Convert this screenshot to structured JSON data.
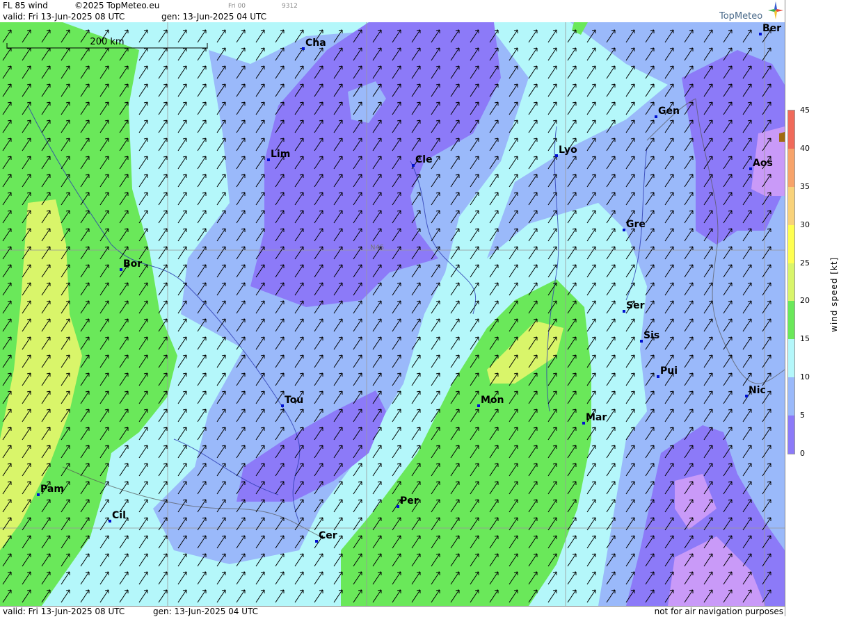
{
  "header": {
    "product": "FL 85 wind",
    "copyright": "©2025 TopMeteo.eu",
    "run_short": "Fri 00",
    "code": "9312",
    "valid": "valid:  Fri  13-Jun-2025  08 UTC",
    "gen": "gen: 13-Jun-2025 04 UTC"
  },
  "footer": {
    "valid": "valid:  Fri  13-Jun-2025  08 UTC",
    "gen": "gen: 13-Jun-2025 04 UTC",
    "disclaimer": "not for air navigation purposes"
  },
  "logo": {
    "text": "TopMeteo"
  },
  "scale_bar": {
    "label": "200 km"
  },
  "gridline_label": "N45",
  "legend": {
    "title": "wind  speed  [kt]",
    "ticks": [
      "45",
      "40",
      "35",
      "30",
      "25",
      "20",
      "15",
      "10",
      "5",
      "0"
    ],
    "colors": [
      "#f06a5a",
      "#f7a36a",
      "#f8d27a",
      "#ffff50",
      "#d9f56a",
      "#6ae85a",
      "#b4f7fa",
      "#9ab9fa",
      "#8c7af8",
      "#c99af8"
    ]
  },
  "cities": [
    {
      "name": "Cha"
    },
    {
      "name": "Lim"
    },
    {
      "name": "Cle"
    },
    {
      "name": "Lyo"
    },
    {
      "name": "Gen"
    },
    {
      "name": "Ber"
    },
    {
      "name": "Aos"
    },
    {
      "name": "Gre"
    },
    {
      "name": "Bor"
    },
    {
      "name": "Ser"
    },
    {
      "name": "Sis"
    },
    {
      "name": "Pui"
    },
    {
      "name": "Nic"
    },
    {
      "name": "Tou"
    },
    {
      "name": "Mon"
    },
    {
      "name": "Mar"
    },
    {
      "name": "Pam"
    },
    {
      "name": "Cil"
    },
    {
      "name": "Per"
    },
    {
      "name": "Cer"
    }
  ]
}
